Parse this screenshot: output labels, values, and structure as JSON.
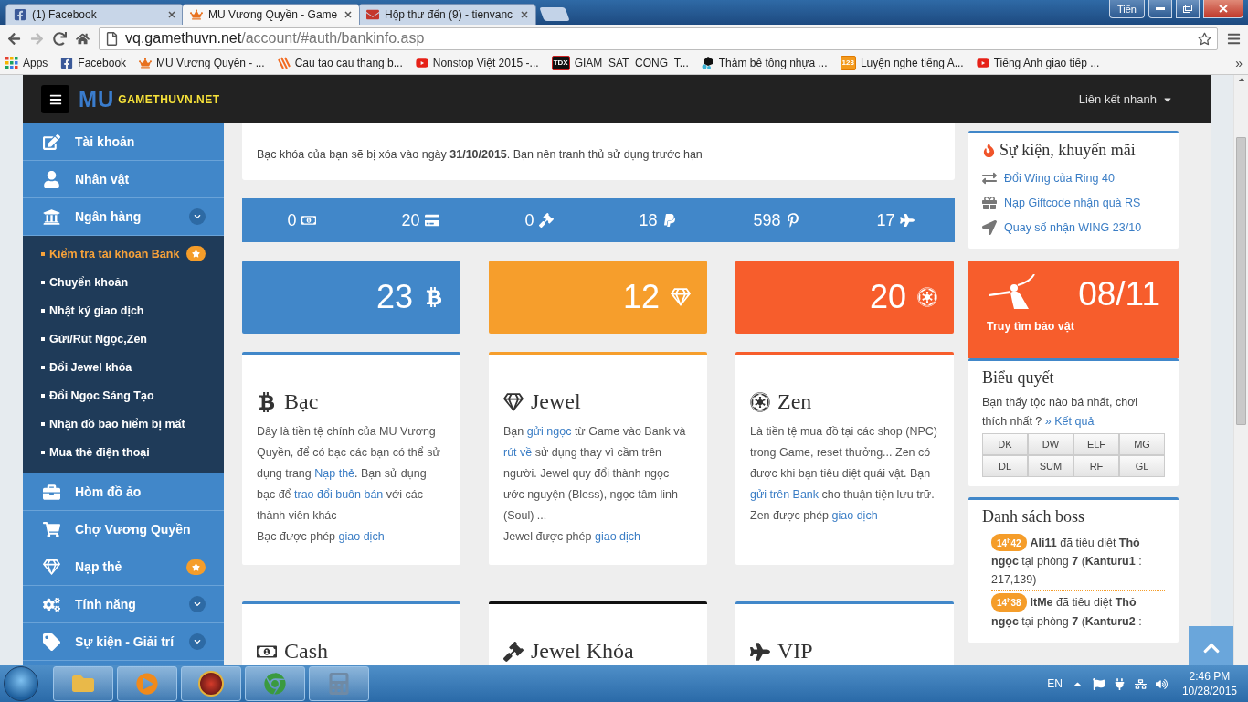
{
  "browser": {
    "tabs": [
      {
        "title": "(1) Facebook",
        "selected": false
      },
      {
        "title": "MU Vương Quyền - Game",
        "selected": true
      },
      {
        "title": "Hộp thư đến (9) - tienvanc",
        "selected": false
      }
    ],
    "user_button": "Tiến",
    "url": {
      "host": "vq.gamethuvn.net",
      "path": "/account/#auth/bankinfo.asp"
    },
    "bookmarks": [
      {
        "label": "Apps"
      },
      {
        "label": "Facebook"
      },
      {
        "label": "MU Vương Quyền - ..."
      },
      {
        "label": "Cau tao cau thang b..."
      },
      {
        "label": "Nonstop Việt 2015 -..."
      },
      {
        "label": "GIAM_SAT_CONG_T...",
        "badge_text": "TDX"
      },
      {
        "label": "Thảm bê tông nhựa ..."
      },
      {
        "label": "Luyện nghe tiếng A...",
        "badge_text": "123"
      },
      {
        "label": "Tiếng Anh giao tiếp ..."
      }
    ],
    "bookmarks_more": "»"
  },
  "navbar": {
    "logo_mark": "MU",
    "logo_text": "GAMETHUVN.NET",
    "quick_links": "Liên kết nhanh"
  },
  "sidebar": {
    "items": [
      {
        "label": "Tài khoản",
        "kind": "link",
        "starred": false
      },
      {
        "label": "Nhân vật",
        "kind": "link",
        "starred": false
      },
      {
        "label": "Ngân hàng",
        "kind": "group",
        "starred": false,
        "expanded": true,
        "children": [
          {
            "label": "Kiểm tra tài khoản Bank",
            "selected": true,
            "starred": true
          },
          {
            "label": "Chuyển khoản",
            "selected": false,
            "starred": false
          },
          {
            "label": "Nhật ký giao dịch",
            "selected": false,
            "starred": false
          },
          {
            "label": "Gửi/Rút Ngọc,Zen",
            "selected": false,
            "starred": false
          },
          {
            "label": "Đổi Jewel khóa",
            "selected": false,
            "starred": false
          },
          {
            "label": "Đổi Ngọc Sáng Tạo",
            "selected": false,
            "starred": false
          },
          {
            "label": "Nhận đồ bảo hiểm bị mất",
            "selected": false,
            "starred": false
          },
          {
            "label": "Mua thẻ điện thoại",
            "selected": false,
            "starred": false
          }
        ]
      },
      {
        "label": "Hòm đồ ảo",
        "kind": "link",
        "starred": false
      },
      {
        "label": "Chợ Vương Quyền",
        "kind": "link",
        "starred": false
      },
      {
        "label": "Nạp thẻ",
        "kind": "link",
        "starred": true
      },
      {
        "label": "Tính năng",
        "kind": "group",
        "starred": false
      },
      {
        "label": "Sự kiện - Giải trí",
        "kind": "group",
        "starred": false
      }
    ]
  },
  "notice": "Bạc khóa của bạn sẽ bị xóa vào ngày **31/10/2015**. Bạn nên tranh thủ sử dụng trước hạn",
  "stats": [
    {
      "value": "0"
    },
    {
      "value": "20"
    },
    {
      "value": "0"
    },
    {
      "value": "18"
    },
    {
      "value": "598"
    },
    {
      "value": "17"
    }
  ],
  "tiles": [
    {
      "value": "23",
      "color": "#4187c9"
    },
    {
      "value": "12",
      "color": "#f69e2c"
    },
    {
      "value": "20",
      "color": "#f75d2c"
    }
  ],
  "cards": [
    {
      "title": "Bạc",
      "color": "#4187c9",
      "paragraphs": [
        [
          {
            "text": "Đây là tiền tệ chính của MU Vương Quyền, để có bạc các bạn có thể sử dụng trang "
          },
          {
            "text": "Nạp thẻ",
            "link": true
          },
          {
            "text": ". Bạn sử dụng bạc để "
          },
          {
            "text": "trao đổi buôn bán",
            "link": true
          },
          {
            "text": " với các thành viên khác"
          }
        ],
        [
          {
            "text": "Bạc được phép "
          },
          {
            "text": "giao dịch",
            "link": true
          }
        ]
      ]
    },
    {
      "title": "Jewel",
      "color": "#f69e2c",
      "paragraphs": [
        [
          {
            "text": "Bạn "
          },
          {
            "text": "gửi ngọc",
            "link": true
          },
          {
            "text": " từ Game vào Bank và "
          },
          {
            "text": "rút về",
            "link": true
          },
          {
            "text": " sử dụng thay vì cầm trên người. Jewel quy đổi thành ngọc ước nguyện (Bless), ngọc tâm linh (Soul) ..."
          }
        ],
        [
          {
            "text": "Jewel được phép "
          },
          {
            "text": "giao dịch",
            "link": true
          }
        ]
      ]
    },
    {
      "title": "Zen",
      "color": "#f75d2c",
      "paragraphs": [
        [
          {
            "text": "Là tiền tệ mua đồ tại các shop (NPC) trong Game, reset thưởng... Zen có được khi bạn tiêu diệt quái vật. Bạn "
          },
          {
            "text": "gửi trên Bank",
            "link": true
          },
          {
            "text": " cho thuận tiện lưu trữ."
          }
        ],
        [
          {
            "text": "Zen được phép "
          },
          {
            "text": "giao dịch",
            "link": true
          }
        ]
      ]
    },
    {
      "title": "Cash",
      "color": "#4187c9"
    },
    {
      "title": "Jewel Khóa",
      "color": "#111111"
    },
    {
      "title": "VIP",
      "color": "#4187c9"
    }
  ],
  "events": {
    "title": "Sự kiện, khuyến mãi",
    "items": [
      {
        "label": "Đổi Wing của Ring 40"
      },
      {
        "label": "Nạp Giftcode nhận quà RS"
      },
      {
        "label": "Quay số nhận WING 23/10"
      }
    ]
  },
  "treasure": {
    "date": "08/11",
    "label": "Truy tìm bảo vật"
  },
  "vote": {
    "title": "Biểu quyết",
    "question": "Bạn thấy tộc nào bá nhất, chơi thích nhất ?",
    "result_link": "» Kết quả",
    "options": [
      "DK",
      "DW",
      "ELF",
      "MG",
      "DL",
      "SUM",
      "RF",
      "GL"
    ]
  },
  "bosses": {
    "title": "Danh sách boss",
    "entries": [
      {
        "time": "14$^{h}$42",
        "text": "**Ali11** đã tiêu diệt **Thỏ ngọc** tại phòng **7** (**Kanturu1** : 217,139)"
      },
      {
        "time": "14$^{h}$38",
        "text": "**ItMe** đã tiêu diệt **Thỏ ngọc** tại phòng **7** (**Kanturu2** :"
      }
    ]
  },
  "taskbar": {
    "language": "EN",
    "time": "2:46 PM",
    "date": "10/28/2015"
  }
}
